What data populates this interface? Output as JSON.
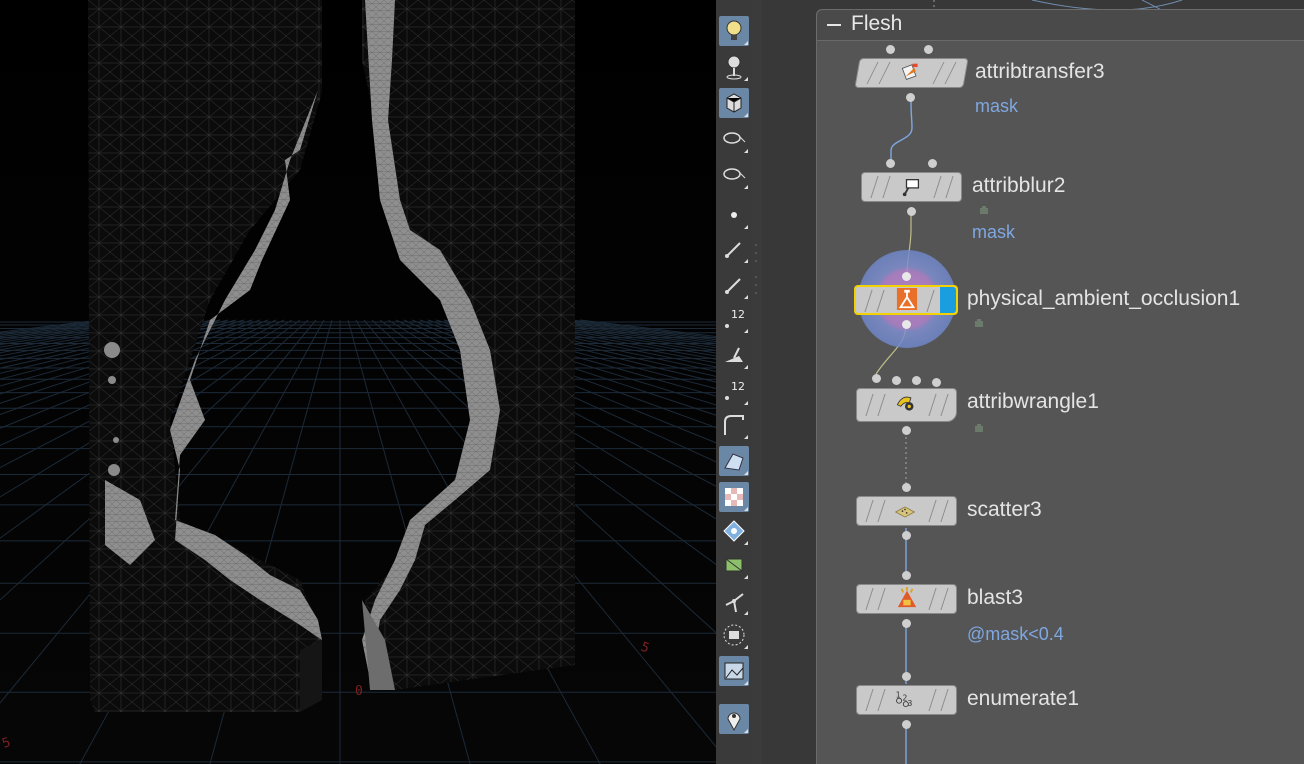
{
  "network": {
    "box_title": "Flesh",
    "nodes": [
      {
        "id": "attribtransfer3",
        "label": "attribtransfer3",
        "comment": "mask",
        "icon": "attribtransfer-icon"
      },
      {
        "id": "attribblur2",
        "label": "attribblur2",
        "comment": "mask",
        "icon": "attribblur-icon"
      },
      {
        "id": "physical_ambient_occlusion1",
        "label": "physical_ambient_occlusion1",
        "comment": "",
        "icon": "ambient-occlusion-icon",
        "selected": true,
        "display_flag": true
      },
      {
        "id": "attribwrangle1",
        "label": "attribwrangle1",
        "comment": "",
        "icon": "attribwrangle-icon"
      },
      {
        "id": "scatter3",
        "label": "scatter3",
        "comment": "",
        "icon": "scatter-icon"
      },
      {
        "id": "blast3",
        "label": "blast3",
        "comment": "@mask<0.4",
        "icon": "blast-icon"
      },
      {
        "id": "enumerate1",
        "label": "enumerate1",
        "comment": "",
        "icon": "enumerate-icon"
      }
    ]
  },
  "toolbar": {
    "tools": [
      {
        "name": "light-tool-icon",
        "active": true
      },
      {
        "name": "camera-pin-icon",
        "active": false
      },
      {
        "name": "shaded-cube-icon",
        "active": true
      },
      {
        "name": "ghost-view-icon",
        "active": false
      },
      {
        "name": "ghost-template-icon",
        "active": false
      },
      {
        "name": "points-icon",
        "active": false
      },
      {
        "name": "normals-icon",
        "active": false
      },
      {
        "name": "vertex-normals-icon",
        "active": false
      },
      {
        "name": "point-numbers-icon",
        "active": false,
        "badge": "12"
      },
      {
        "name": "prim-normals-icon",
        "active": false
      },
      {
        "name": "prim-numbers-icon",
        "active": false,
        "badge": "12"
      },
      {
        "name": "curve-icon",
        "active": false
      },
      {
        "name": "wire-shaded-icon",
        "active": true
      },
      {
        "name": "checker-texture-icon",
        "active": true
      },
      {
        "name": "diamond-icon",
        "active": false
      },
      {
        "name": "uv-icon",
        "active": false
      },
      {
        "name": "pivot-icon",
        "active": false
      },
      {
        "name": "snapshot-icon",
        "active": false
      },
      {
        "name": "background-image-icon",
        "active": true
      },
      {
        "name": "pin-icon",
        "active": true
      }
    ]
  },
  "viewport": {
    "grid_labels": [
      "0",
      "5",
      "5"
    ]
  },
  "colors": {
    "accent_blue": "#7fa7e0",
    "selected_outline": "#f2d200",
    "display_flag": "#1a9ee0",
    "network_bg": "#383838",
    "netbox_bg": "#555555"
  }
}
